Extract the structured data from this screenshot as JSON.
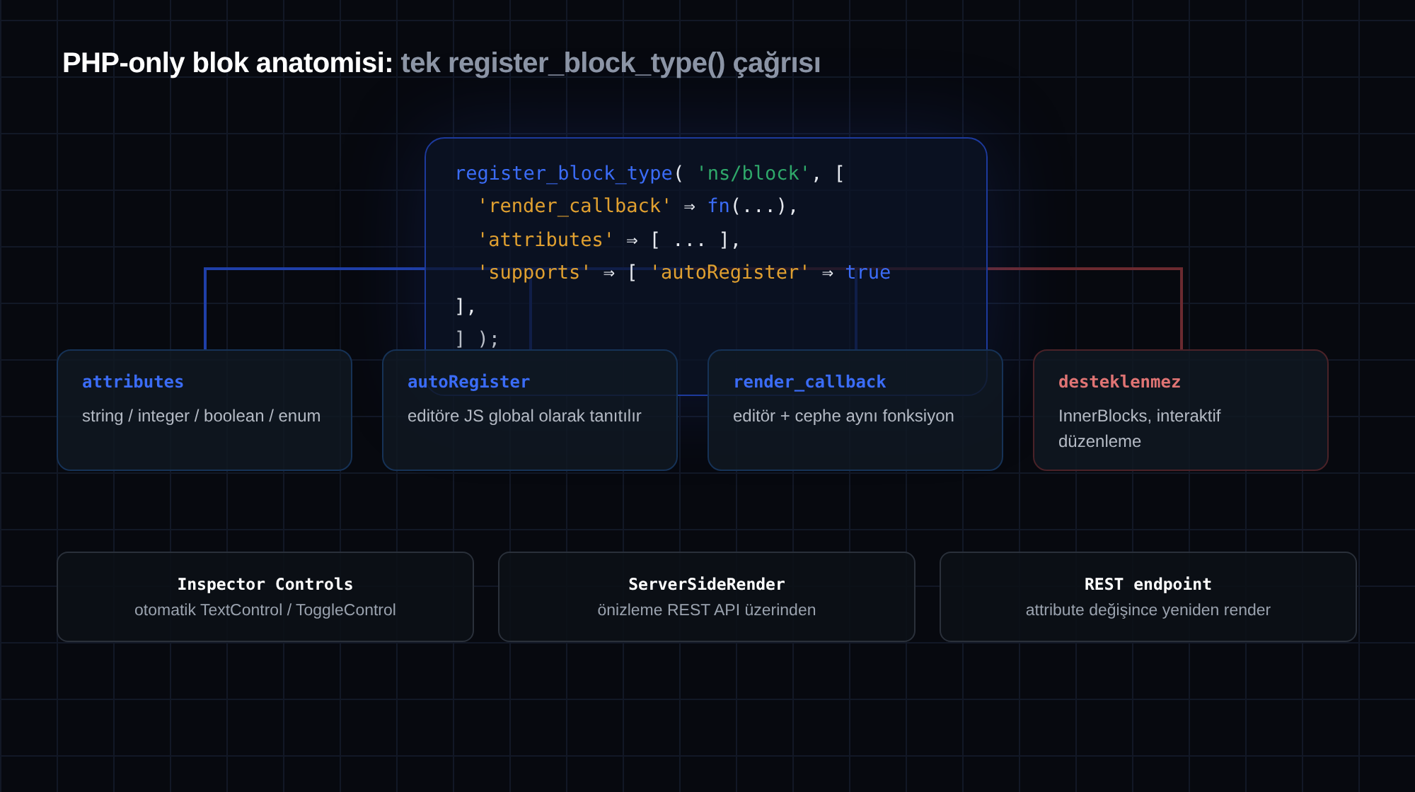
{
  "title": "**PHP-only blok anatomisi:** tek register_block_type() çağrısı",
  "code": [
    {
      "indented": false,
      "tokens": [
        {
          "kind": "fn",
          "text": "register_block_type"
        },
        {
          "kind": "plain",
          "text": "( "
        },
        {
          "kind": "string",
          "text": "'ns/block'"
        },
        {
          "kind": "plain",
          "text": ", ["
        }
      ]
    },
    {
      "indented": true,
      "tokens": [
        {
          "kind": "key",
          "text": "'render_callback'"
        },
        {
          "kind": "plain",
          "text": " ⇒ "
        },
        {
          "kind": "fn",
          "text": "fn"
        },
        {
          "kind": "plain",
          "text": "(...),"
        }
      ]
    },
    {
      "indented": true,
      "tokens": [
        {
          "kind": "key",
          "text": "'attributes'"
        },
        {
          "kind": "plain",
          "text": " ⇒ [ ... ],"
        }
      ]
    },
    {
      "indented": true,
      "tokens": [
        {
          "kind": "key",
          "text": "'supports'"
        },
        {
          "kind": "plain",
          "text": " ⇒ [ "
        },
        {
          "kind": "key",
          "text": "'autoRegister'"
        },
        {
          "kind": "plain",
          "text": " ⇒ "
        },
        {
          "kind": "fn",
          "text": "true"
        }
      ]
    },
    {
      "indented": false,
      "tokens": [
        {
          "kind": "plain",
          "text": "],"
        }
      ]
    },
    {
      "indented": false,
      "tokens": [
        {
          "kind": "dim",
          "text": "] );"
        }
      ]
    }
  ],
  "cards": [
    {
      "label": "attributes",
      "description": "string / integer / boolean / enum",
      "kind": "supported"
    },
    {
      "label": "autoRegister",
      "description": "editöre JS global olarak tanıtılır",
      "kind": "supported"
    },
    {
      "label": "render_callback",
      "description": "editör + cephe aynı fonksiyon",
      "kind": "supported"
    },
    {
      "label": "desteklenmez",
      "description": "InnerBlocks, interaktif düzenleme",
      "kind": "unsupported"
    }
  ],
  "features": [
    {
      "title": "Inspector Controls",
      "description": "otomatik TextControl / ToggleControl"
    },
    {
      "title": "ServerSideRender",
      "description": "önizleme REST API üzerinden"
    },
    {
      "title": "REST endpoint",
      "description": "attribute değişince yeniden render"
    }
  ]
}
